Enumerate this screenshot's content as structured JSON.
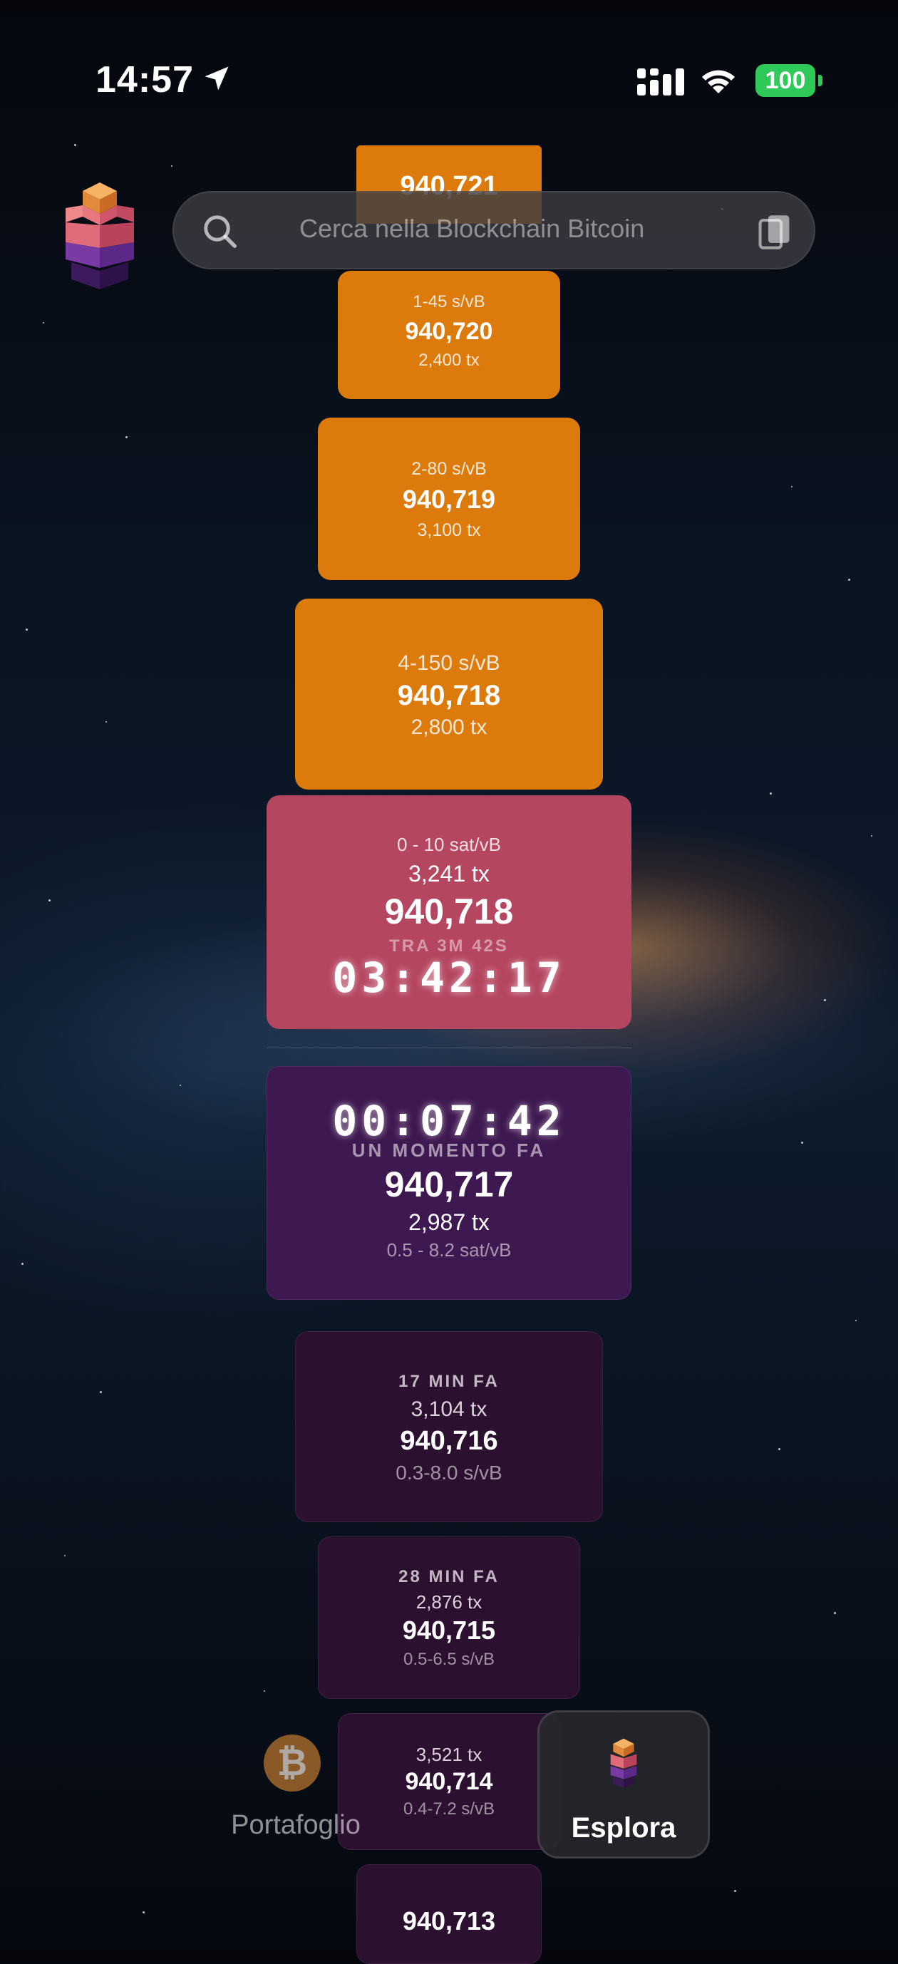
{
  "status_bar": {
    "time": "14:57",
    "battery": "100"
  },
  "search": {
    "placeholder": "Cerca nella Blockchain Bitcoin"
  },
  "projected_blocks": [
    {
      "height": "940,721"
    },
    {
      "fee": "1-45 s/vB",
      "height": "940,720",
      "txs": "2,400 tx"
    },
    {
      "fee": "2-80 s/vB",
      "height": "940,719",
      "txs": "3,100 tx"
    },
    {
      "fee": "4-150 s/vB",
      "height": "940,718",
      "txs": "2,800 tx"
    }
  ],
  "next_block": {
    "fee": "0 - 10 sat/vB",
    "txs": "3,241 tx",
    "height": "940,718",
    "eta": "TRA 3M 42S",
    "countdown": "03:42:17"
  },
  "latest_block": {
    "elapsed": "00:07:42",
    "when": "UN MOMENTO FA",
    "height": "940,717",
    "txs": "2,987 tx",
    "fee": "0.5 - 8.2 sat/vB"
  },
  "mined_blocks": [
    {
      "when": "17 MIN FA",
      "txs": "3,104 tx",
      "height": "940,716",
      "fee": "0.3-8.0 s/vB"
    },
    {
      "when": "28 MIN FA",
      "txs": "2,876 tx",
      "height": "940,715",
      "fee": "0.5-6.5 s/vB"
    },
    {
      "txs": "3,521 tx",
      "height": "940,714",
      "fee": "0.4-7.2 s/vB"
    },
    {
      "height": "940,713"
    }
  ],
  "tabs": {
    "wallet": "Portafoglio",
    "explore": "Esplora"
  },
  "colors": {
    "projected": "#dd7a0c",
    "pending": "#b54660",
    "latest": "#3e1850",
    "mined": "#2c1030",
    "battery": "#2fc95a"
  }
}
